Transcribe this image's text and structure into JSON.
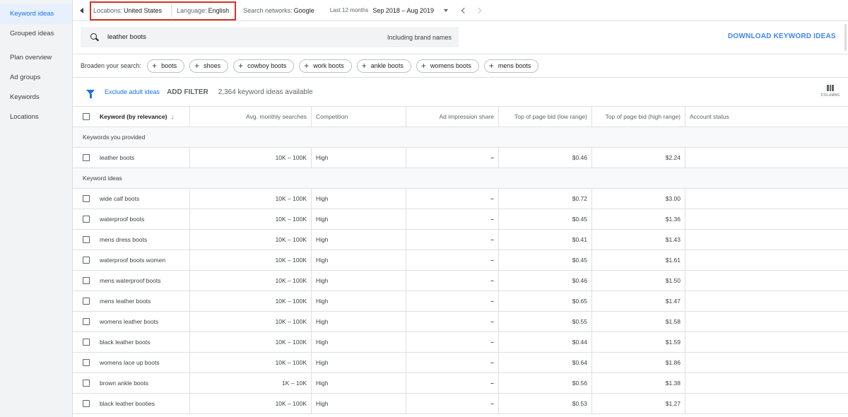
{
  "sidebar": {
    "items": [
      {
        "label": "Keyword ideas",
        "active": true
      },
      {
        "label": "Grouped ideas",
        "active": false
      },
      {
        "label": "Plan overview",
        "active": false
      },
      {
        "label": "Ad groups",
        "active": false
      },
      {
        "label": "Keywords",
        "active": false
      },
      {
        "label": "Locations",
        "active": false
      }
    ]
  },
  "topbar": {
    "locations_label": "Locations:",
    "locations_value": "United States",
    "language_label": "Language:",
    "language_value": "English",
    "networks_label": "Search networks:",
    "networks_value": "Google",
    "period_label": "Last 12 months",
    "period_value": "Sep 2018 – Aug 2019",
    "highlight_color": "#d93025"
  },
  "search": {
    "query": "leather boots",
    "brand_note": "Including brand names",
    "download_label": "DOWNLOAD KEYWORD IDEAS"
  },
  "broaden": {
    "label": "Broaden your search:",
    "chips": [
      "boots",
      "shoes",
      "cowboy boots",
      "work boots",
      "ankle boots",
      "womens boots",
      "mens boots"
    ]
  },
  "filter": {
    "exclude_label": "Exclude adult ideas",
    "add_filter_label": "ADD FILTER",
    "available": "2,364 keyword ideas available",
    "columns_label": "COLUMNS"
  },
  "table": {
    "headers": {
      "keyword": "Keyword (by relevance)",
      "avg": "Avg. monthly searches",
      "competition": "Competition",
      "impression": "Ad impression share",
      "bid_low": "Top of page bid (low range)",
      "bid_high": "Top of page bid (high range)",
      "account": "Account status"
    },
    "provided_label": "Keywords you provided",
    "provided": [
      {
        "keyword": "leather boots",
        "avg": "10K – 100K",
        "competition": "High",
        "impression": "–",
        "low": "$0.46",
        "high": "$2.24"
      }
    ],
    "ideas_label": "Keyword ideas",
    "ideas": [
      {
        "keyword": "wide calf boots",
        "avg": "10K – 100K",
        "competition": "High",
        "impression": "–",
        "low": "$0.72",
        "high": "$3.00"
      },
      {
        "keyword": "waterproof boots",
        "avg": "10K – 100K",
        "competition": "High",
        "impression": "–",
        "low": "$0.45",
        "high": "$1.36"
      },
      {
        "keyword": "mens dress boots",
        "avg": "10K – 100K",
        "competition": "High",
        "impression": "–",
        "low": "$0.41",
        "high": "$1.43"
      },
      {
        "keyword": "waterproof boots women",
        "avg": "10K – 100K",
        "competition": "High",
        "impression": "–",
        "low": "$0.45",
        "high": "$1.61"
      },
      {
        "keyword": "mens waterproof boots",
        "avg": "10K – 100K",
        "competition": "High",
        "impression": "–",
        "low": "$0.46",
        "high": "$1.50"
      },
      {
        "keyword": "mens leather boots",
        "avg": "10K – 100K",
        "competition": "High",
        "impression": "–",
        "low": "$0.65",
        "high": "$1.47"
      },
      {
        "keyword": "womens leather boots",
        "avg": "10K – 100K",
        "competition": "High",
        "impression": "–",
        "low": "$0.55",
        "high": "$1.58"
      },
      {
        "keyword": "black leather boots",
        "avg": "10K – 100K",
        "competition": "High",
        "impression": "–",
        "low": "$0.44",
        "high": "$1.59"
      },
      {
        "keyword": "womens lace up boots",
        "avg": "10K – 100K",
        "competition": "High",
        "impression": "–",
        "low": "$0.64",
        "high": "$1.86"
      },
      {
        "keyword": "brown ankle boots",
        "avg": "1K – 10K",
        "competition": "High",
        "impression": "–",
        "low": "$0.56",
        "high": "$1.38"
      },
      {
        "keyword": "black leather booties",
        "avg": "10K – 100K",
        "competition": "High",
        "impression": "–",
        "low": "$0.53",
        "high": "$1.27"
      }
    ]
  }
}
